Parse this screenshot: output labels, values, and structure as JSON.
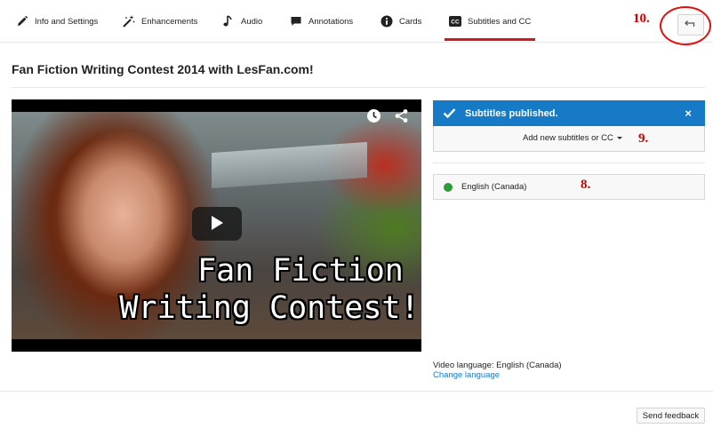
{
  "tabs": [
    {
      "label": "Info and Settings",
      "icon": "pencil-icon"
    },
    {
      "label": "Enhancements",
      "icon": "magic-wand-icon"
    },
    {
      "label": "Audio",
      "icon": "music-note-icon"
    },
    {
      "label": "Annotations",
      "icon": "speech-bubble-icon"
    },
    {
      "label": "Cards",
      "icon": "info-icon"
    },
    {
      "label": "Subtitles and CC",
      "icon": "cc-icon",
      "active": true
    }
  ],
  "annotations": {
    "a10": "10.",
    "a9": "9.",
    "a8": "8."
  },
  "back_button": {
    "icon": "back-arrow-icon"
  },
  "video": {
    "title": "Fan Fiction Writing Contest 2014 with LesFan.com!",
    "caption_line1": "Fan Fiction",
    "caption_line2": "Writing Contest!",
    "icons": [
      "clock-icon",
      "share-icon",
      "play-icon"
    ]
  },
  "subtitles": {
    "published_message": "Subtitles published.",
    "close_label": "×",
    "add_button": "Add new subtitles or CC",
    "languages": [
      {
        "label": "English (Canada)",
        "status_color": "#2a9d3a"
      }
    ]
  },
  "video_language": {
    "label": "Video language:",
    "value": "English (Canada)",
    "change_link": "Change language"
  },
  "footer": {
    "send_feedback": "Send feedback"
  },
  "colors": {
    "accent_red": "#cc181e",
    "notice_blue": "#167ac6",
    "annotation_red": "#cc0000"
  }
}
